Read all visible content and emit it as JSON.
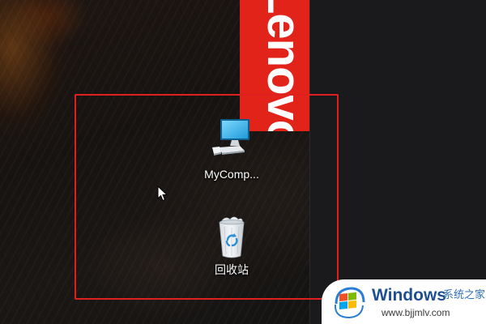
{
  "lenovo_banner": {
    "text": "Lenovo",
    "color": "#e2231a"
  },
  "highlight": {
    "color": "#e02020"
  },
  "desktop_icons": [
    {
      "label": "MyComp...",
      "icon": "computer-icon"
    },
    {
      "label": "回收站",
      "icon": "recycle-bin-icon"
    }
  ],
  "watermark": {
    "brand": "Windows",
    "subtitle": "系统之家",
    "url": "www.bjjmlv.com",
    "icon": "windows-logo-icon"
  }
}
